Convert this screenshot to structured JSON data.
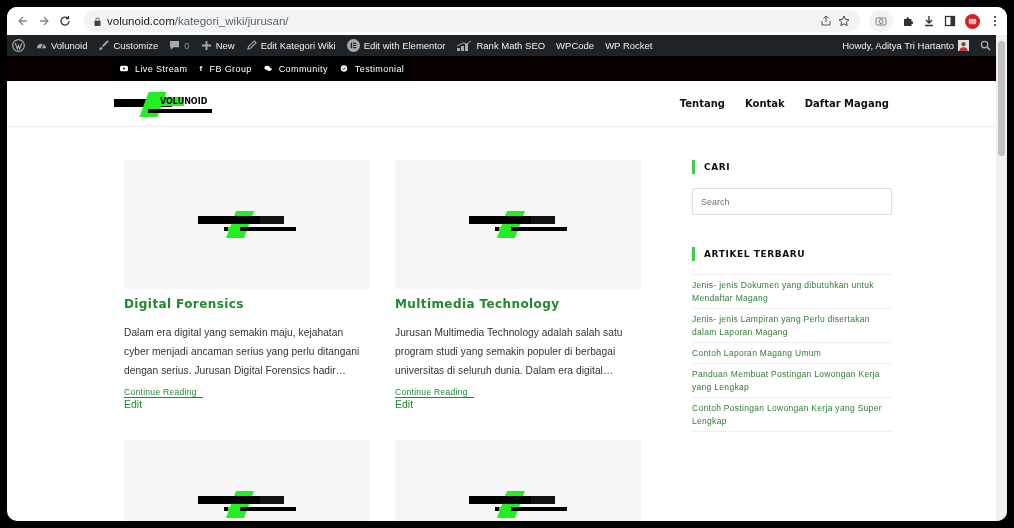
{
  "browser": {
    "url_domain": "volunoid.com",
    "url_path": "/kategori_wiki/jurusan/"
  },
  "admin_bar": {
    "items": [
      {
        "kind": "wp"
      },
      {
        "kind": "dashboard",
        "label": "Volunoid"
      },
      {
        "kind": "brush",
        "label": "Customize"
      },
      {
        "kind": "comment",
        "label": "0"
      },
      {
        "kind": "plus",
        "label": "New"
      },
      {
        "kind": "pencil",
        "label": "Edit Kategori Wiki"
      },
      {
        "kind": "elementor",
        "label": "Edit with Elementor"
      },
      {
        "kind": "chart",
        "label": "Rank Math SEO"
      },
      {
        "kind": "text",
        "label": "WPCode"
      },
      {
        "kind": "text",
        "label": "WP Rocket"
      }
    ],
    "greeting": "Howdy, Aditya Tri Hartanto"
  },
  "top_bar": [
    {
      "kind": "youtube",
      "label": "Live Stream"
    },
    {
      "kind": "facebook",
      "glyph": "f",
      "label": "FB Group"
    },
    {
      "kind": "chat",
      "label": "Community"
    },
    {
      "kind": "check",
      "label": "Testimonial"
    }
  ],
  "header": {
    "logo": {
      "highlight": "VOLU",
      "rest": "NOID"
    },
    "nav": [
      "Tentang",
      "Kontak",
      "Daftar Magang"
    ]
  },
  "posts": [
    {
      "title": "Digital Forensics",
      "excerpt": "Dalam era digital yang semakin maju, kejahatan cyber menjadi ancaman serius yang perlu ditangani dengan serius. Jurusan Digital Forensics hadir…",
      "more": "Continue Reading",
      "edit": "Edit"
    },
    {
      "title": "Multimedia Technology",
      "excerpt": "Jurusan Multimedia Technology adalah salah satu program studi yang semakin populer di berbagai universitas di seluruh dunia. Dalam era digital…",
      "more": "Continue Reading",
      "edit": "Edit"
    },
    {
      "kind": "picture"
    },
    {
      "kind": "picture"
    }
  ],
  "sidebar": {
    "search_title": "CARI",
    "search": {
      "placeholder": "Search"
    },
    "recent_title": "ARTIKEL TERBARU",
    "recent": [
      "Jenis- jenis Dokumen yang dibutuhkan untuk Mendaftar Magang",
      "Jenis- jenis Lampiran yang Perlu disertakan dalam Laporan Magang",
      "Contoh Laporan Magang Umum",
      "Panduan Membuat Postingan Lowongan Kerja yang Lengkap",
      "Contoh Postingan Lowongan Kerja yang Super Lengkap"
    ]
  }
}
